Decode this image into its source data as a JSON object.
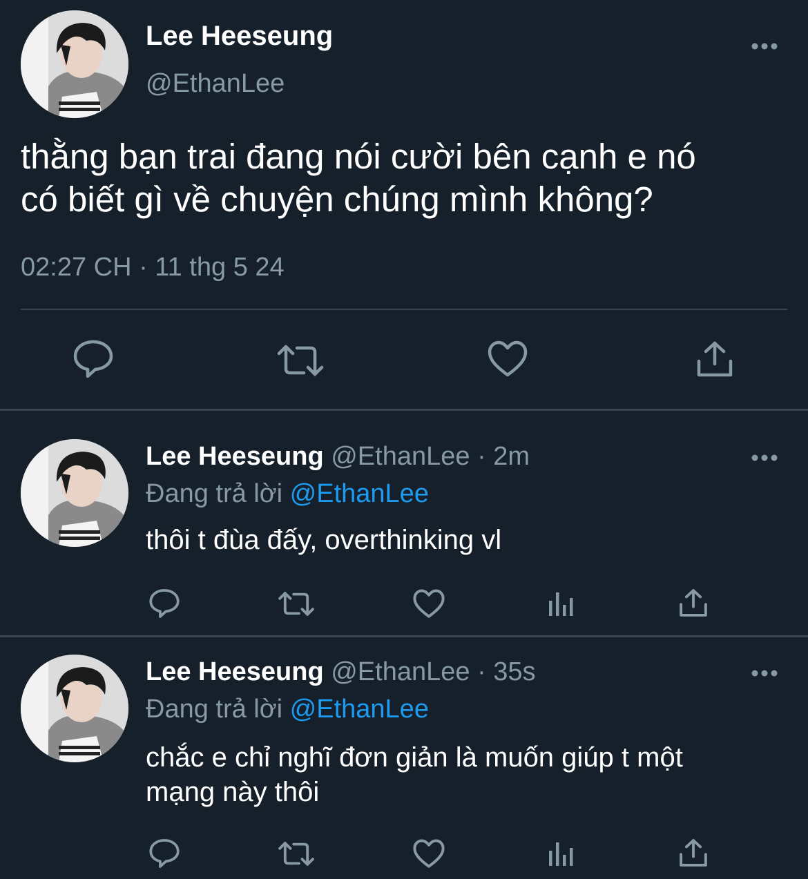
{
  "main_tweet": {
    "display_name": "Lee Heeseung",
    "handle": "@EthanLee",
    "text_line1": "thằng bạn trai đang nói cười bên cạnh e nó",
    "text_line2": "có biết gì về chuyện chúng mình không?",
    "timestamp": "02:27 CH · 11 thg 5 24",
    "actions": [
      "reply-icon",
      "retweet-icon",
      "like-icon",
      "share-icon"
    ]
  },
  "replies": [
    {
      "display_name": "Lee Heeseung",
      "handle": "@EthanLee",
      "time": "· 2m",
      "replying_prefix": "Đang trả lời",
      "replying_to": "@EthanLee",
      "text_line1": "thôi t đùa đấy, overthinking vl",
      "actions": [
        "reply-icon",
        "retweet-icon",
        "like-icon",
        "analytics-icon",
        "share-icon"
      ]
    },
    {
      "display_name": "Lee Heeseung",
      "handle": "@EthanLee",
      "time": "· 35s",
      "replying_prefix": "Đang trả lời",
      "replying_to": "@EthanLee",
      "text_line1": "chắc e chỉ nghĩ đơn giản là muốn giúp t một",
      "text_line2": "mạng này thôi",
      "actions": [
        "reply-icon",
        "retweet-icon",
        "like-icon",
        "analytics-icon",
        "share-icon"
      ]
    }
  ],
  "colors": {
    "background": "#15202b",
    "text": "#ffffff",
    "muted": "#8899a6",
    "link": "#1d9bf0",
    "divider": "#38444d"
  }
}
